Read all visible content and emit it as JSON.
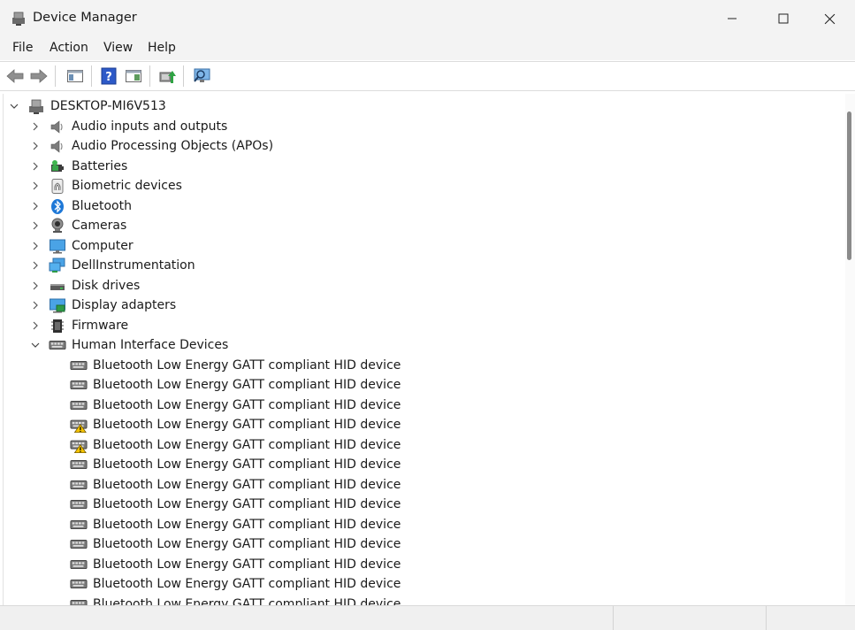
{
  "window": {
    "title": "Device Manager",
    "controls": [
      "minimize",
      "maximize",
      "close"
    ]
  },
  "menu": [
    {
      "label": "File"
    },
    {
      "label": "Action"
    },
    {
      "label": "View"
    },
    {
      "label": "Help"
    }
  ],
  "toolbar": {
    "buttons": [
      "back-icon",
      "forward-icon",
      "show-hide-console-tree-icon",
      "help-icon",
      "properties-icon",
      "update-driver-icon",
      "scan-hardware-icon"
    ]
  },
  "tree": {
    "root": {
      "label": "DESKTOP-MI6V513",
      "icon": "computer-root-icon",
      "expanded": true
    },
    "categories": [
      {
        "label": "Audio inputs and outputs",
        "icon": "speaker-icon"
      },
      {
        "label": "Audio Processing Objects (APOs)",
        "icon": "speaker-icon"
      },
      {
        "label": "Batteries",
        "icon": "battery-icon"
      },
      {
        "label": "Biometric devices",
        "icon": "fingerprint-icon"
      },
      {
        "label": "Bluetooth",
        "icon": "bluetooth-icon"
      },
      {
        "label": "Cameras",
        "icon": "webcam-icon"
      },
      {
        "label": "Computer",
        "icon": "monitor-icon"
      },
      {
        "label": "DellInstrumentation",
        "icon": "network-monitor-icon"
      },
      {
        "label": "Disk drives",
        "icon": "disk-drive-icon"
      },
      {
        "label": "Display adapters",
        "icon": "display-adapter-icon"
      },
      {
        "label": "Firmware",
        "icon": "firmware-chip-icon"
      },
      {
        "label": "Human Interface Devices",
        "icon": "hid-icon",
        "expanded": true
      }
    ],
    "hid_devices": [
      {
        "label": "Bluetooth Low Energy GATT compliant HID device",
        "warning": false
      },
      {
        "label": "Bluetooth Low Energy GATT compliant HID device",
        "warning": false
      },
      {
        "label": "Bluetooth Low Energy GATT compliant HID device",
        "warning": false
      },
      {
        "label": "Bluetooth Low Energy GATT compliant HID device",
        "warning": true
      },
      {
        "label": "Bluetooth Low Energy GATT compliant HID device",
        "warning": true
      },
      {
        "label": "Bluetooth Low Energy GATT compliant HID device",
        "warning": false
      },
      {
        "label": "Bluetooth Low Energy GATT compliant HID device",
        "warning": false
      },
      {
        "label": "Bluetooth Low Energy GATT compliant HID device",
        "warning": false
      },
      {
        "label": "Bluetooth Low Energy GATT compliant HID device",
        "warning": false
      },
      {
        "label": "Bluetooth Low Energy GATT compliant HID device",
        "warning": false
      },
      {
        "label": "Bluetooth Low Energy GATT compliant HID device",
        "warning": false
      },
      {
        "label": "Bluetooth Low Energy GATT compliant HID device",
        "warning": false
      },
      {
        "label": "Bluetooth Low Energy GATT compliant HID device",
        "warning": false
      }
    ]
  },
  "colors": {
    "chrome_bg": "#f3f3f3",
    "warning": "#f5c400",
    "bluetooth": "#1e78d7"
  }
}
